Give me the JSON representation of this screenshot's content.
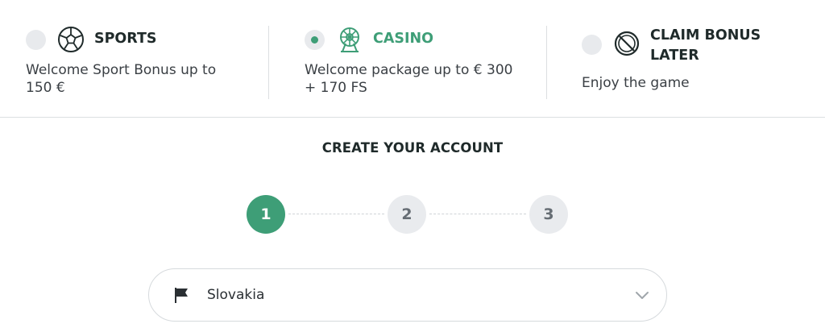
{
  "bonus_options": [
    {
      "title": "SPORTS",
      "description": "Welcome Sport Bonus up to 150 €",
      "selected": false,
      "icon": "soccer-ball-icon"
    },
    {
      "title": "CASINO",
      "description": "Welcome package up to € 300 + 170 FS",
      "selected": true,
      "icon": "ferris-wheel-icon"
    },
    {
      "title": "CLAIM BONUS LATER",
      "description": "Enjoy the game",
      "selected": false,
      "icon": "no-bonus-icon"
    }
  ],
  "registration": {
    "title": "CREATE YOUR ACCOUNT",
    "steps": [
      "1",
      "2",
      "3"
    ],
    "current_step": 1,
    "country": {
      "value": "Slovakia",
      "icon": "flag-icon"
    }
  },
  "colors": {
    "accent": "#3e9e77",
    "inactive_step": "#e9ebee",
    "text": "#1f2a2a",
    "divider": "#dcdfe1"
  }
}
